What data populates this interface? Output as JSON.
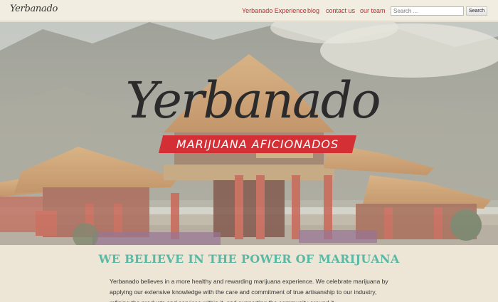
{
  "header": {
    "logo_text": "Yerbanado",
    "nav": [
      {
        "label": "Yerbanado Experience"
      },
      {
        "label": "blog"
      },
      {
        "label": "contact us"
      },
      {
        "label": "our team"
      }
    ],
    "search": {
      "placeholder": "Search ...",
      "button_label": "Search"
    }
  },
  "hero": {
    "title": "Yerbanado",
    "tagline": "MARIJUANA AFICIONADOS",
    "image_description": "chinese-temple-gate-photo"
  },
  "main": {
    "heading": "WE BELIEVE IN THE POWER OF MARIJUANA",
    "paragraph": "Yerbanado believes in a more healthy and rewarding marijuana experience. We celebrate marijuana by applying our extensive knowledge with the care and commitment of true artisanship to our industry, refining the products and services within it, and supporting the community around it."
  },
  "colors": {
    "accent_red": "#c1272d",
    "banner_red": "#d42f34",
    "heading_teal": "#5bb8a4",
    "background": "#ede6d6"
  }
}
